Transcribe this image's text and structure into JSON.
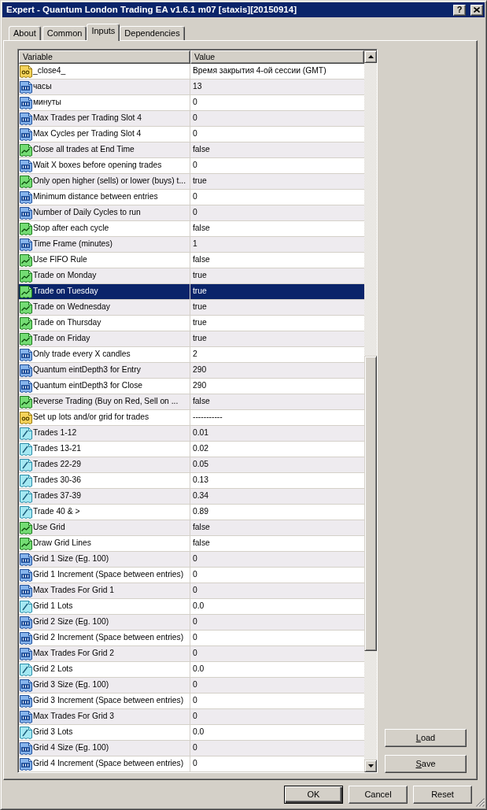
{
  "window": {
    "title": "Expert - Quantum London Trading EA v1.6.1 m07 [staxis][20150914]",
    "help_button": "?"
  },
  "tabs": [
    {
      "label": "About",
      "selected": false
    },
    {
      "label": "Common",
      "selected": false
    },
    {
      "label": "Inputs",
      "selected": true
    },
    {
      "label": "Dependencies",
      "selected": false
    }
  ],
  "table": {
    "columns": [
      "Variable",
      "Value"
    ],
    "rows": [
      {
        "kind": "string",
        "variable": "_close4_",
        "value": "Время закрытия 4-ой сессии (GMT)",
        "selected": false
      },
      {
        "kind": "int",
        "variable": "часы",
        "value": "13",
        "selected": false
      },
      {
        "kind": "int",
        "variable": "минуты",
        "value": "0",
        "selected": false
      },
      {
        "kind": "int",
        "variable": "Max Trades per Trading Slot 4",
        "value": "0",
        "selected": false
      },
      {
        "kind": "int",
        "variable": "Max Cycles per Trading Slot 4",
        "value": "0",
        "selected": false
      },
      {
        "kind": "bool",
        "variable": "Close all trades at End Time",
        "value": "false",
        "selected": false
      },
      {
        "kind": "int",
        "variable": "Wait X boxes before opening trades",
        "value": "0",
        "selected": false
      },
      {
        "kind": "bool",
        "variable": "Only open higher (sells) or lower (buys) t...",
        "value": "true",
        "selected": false
      },
      {
        "kind": "int",
        "variable": "Minimum distance between entries",
        "value": "0",
        "selected": false
      },
      {
        "kind": "int",
        "variable": "Number of Daily Cycles to run",
        "value": "0",
        "selected": false
      },
      {
        "kind": "bool",
        "variable": "Stop after each cycle",
        "value": "false",
        "selected": false
      },
      {
        "kind": "int",
        "variable": "Time Frame (minutes)",
        "value": "1",
        "selected": false
      },
      {
        "kind": "bool",
        "variable": "Use FIFO Rule",
        "value": "false",
        "selected": false
      },
      {
        "kind": "bool",
        "variable": "Trade on Monday",
        "value": "true",
        "selected": false
      },
      {
        "kind": "bool",
        "variable": "Trade on Tuesday",
        "value": "true",
        "selected": true
      },
      {
        "kind": "bool",
        "variable": "Trade on Wednesday",
        "value": "true",
        "selected": false
      },
      {
        "kind": "bool",
        "variable": "Trade on Thursday",
        "value": "true",
        "selected": false
      },
      {
        "kind": "bool",
        "variable": "Trade on Friday",
        "value": "true",
        "selected": false
      },
      {
        "kind": "int",
        "variable": "Only trade every X candles",
        "value": "2",
        "selected": false
      },
      {
        "kind": "int",
        "variable": "Quantum eintDepth3 for Entry",
        "value": "290",
        "selected": false
      },
      {
        "kind": "int",
        "variable": "Quantum eintDepth3 for Close",
        "value": "290",
        "selected": false
      },
      {
        "kind": "bool",
        "variable": "Reverse Trading (Buy on Red, Sell on ...",
        "value": "false",
        "selected": false
      },
      {
        "kind": "string",
        "variable": "Set up lots and/or grid for trades",
        "value": "-----------",
        "selected": false
      },
      {
        "kind": "double",
        "variable": "Trades 1-12",
        "value": "0.01",
        "selected": false
      },
      {
        "kind": "double",
        "variable": "Trades 13-21",
        "value": "0.02",
        "selected": false
      },
      {
        "kind": "double",
        "variable": "Trades 22-29",
        "value": "0.05",
        "selected": false
      },
      {
        "kind": "double",
        "variable": "Trades 30-36",
        "value": "0.13",
        "selected": false
      },
      {
        "kind": "double",
        "variable": "Trades 37-39",
        "value": "0.34",
        "selected": false
      },
      {
        "kind": "double",
        "variable": "Trade 40 & >",
        "value": "0.89",
        "selected": false
      },
      {
        "kind": "bool",
        "variable": "Use Grid",
        "value": "false",
        "selected": false
      },
      {
        "kind": "bool",
        "variable": "Draw Grid Lines",
        "value": "false",
        "selected": false
      },
      {
        "kind": "int",
        "variable": "Grid 1 Size (Eg. 100)",
        "value": "0",
        "selected": false
      },
      {
        "kind": "int",
        "variable": "Grid 1 Increment (Space between entries)",
        "value": "0",
        "selected": false
      },
      {
        "kind": "int",
        "variable": "Max Trades For Grid 1",
        "value": "0",
        "selected": false
      },
      {
        "kind": "double",
        "variable": "Grid 1 Lots",
        "value": "0.0",
        "selected": false
      },
      {
        "kind": "int",
        "variable": "Grid 2 Size (Eg. 100)",
        "value": "0",
        "selected": false
      },
      {
        "kind": "int",
        "variable": "Grid 2 Increment (Space between entries)",
        "value": "0",
        "selected": false
      },
      {
        "kind": "int",
        "variable": "Max Trades For Grid 2",
        "value": "0",
        "selected": false
      },
      {
        "kind": "double",
        "variable": "Grid 2 Lots",
        "value": "0.0",
        "selected": false
      },
      {
        "kind": "int",
        "variable": "Grid 3 Size (Eg. 100)",
        "value": "0",
        "selected": false
      },
      {
        "kind": "int",
        "variable": "Grid 3 Increment (Space between entries)",
        "value": "0",
        "selected": false
      },
      {
        "kind": "int",
        "variable": "Max Trades For Grid 3",
        "value": "0",
        "selected": false
      },
      {
        "kind": "double",
        "variable": "Grid 3 Lots",
        "value": "0.0",
        "selected": false
      },
      {
        "kind": "int",
        "variable": "Grid 4 Size (Eg. 100)",
        "value": "0",
        "selected": false
      },
      {
        "kind": "int",
        "variable": "Grid 4 Increment (Space between entries)",
        "value": "0",
        "selected": false
      }
    ]
  },
  "side_buttons": [
    {
      "label": "Load",
      "mnemonic": true
    },
    {
      "label": "Save",
      "mnemonic": true
    }
  ],
  "buttons": [
    {
      "label": "OK",
      "default": true
    },
    {
      "label": "Cancel",
      "default": false
    },
    {
      "label": "Reset",
      "default": false
    }
  ]
}
